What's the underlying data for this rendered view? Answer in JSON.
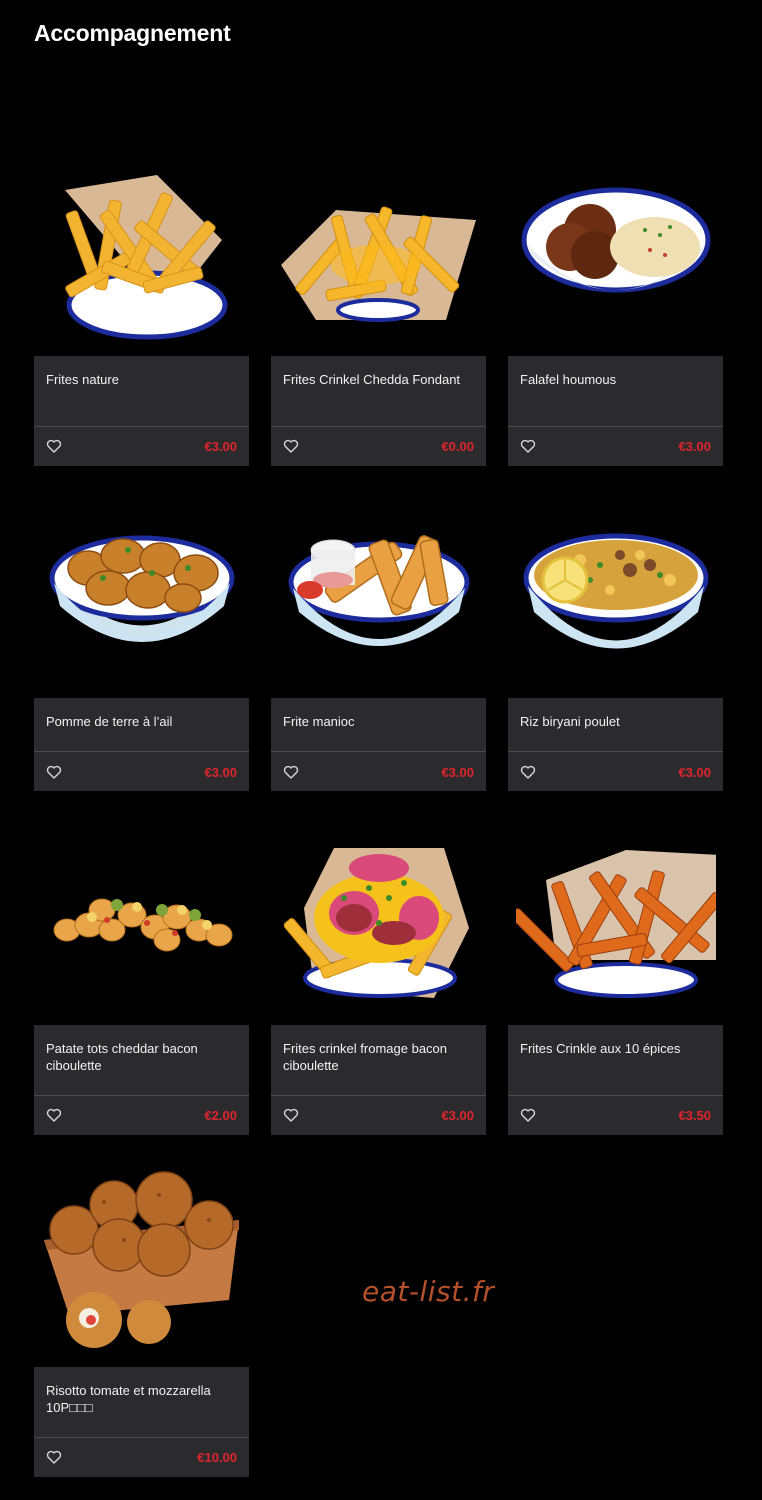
{
  "section": {
    "title": "Accompagnement"
  },
  "colors": {
    "background": "#000000",
    "card": "#2b2b2e",
    "price": "#e0242c",
    "watermark": "#b4512a"
  },
  "items": [
    {
      "name": "Frites nature",
      "price": "€3.00",
      "image": "fries-bowl",
      "icon": "heart-icon"
    },
    {
      "name": "Frites Crinkel Chedda Fondant",
      "price": "€0.00",
      "image": "cheese-fries-tray",
      "icon": "heart-icon"
    },
    {
      "name": "Falafel houmous",
      "price": "€3.00",
      "image": "falafel-hummus-bowl",
      "icon": "heart-icon"
    },
    {
      "name": "Pomme de terre à l’ail",
      "price": "€3.00",
      "image": "garlic-potatoes-bowl",
      "icon": "heart-icon"
    },
    {
      "name": "Frite manioc",
      "price": "€3.00",
      "image": "cassava-fries-bowl",
      "icon": "heart-icon"
    },
    {
      "name": "Riz biryani poulet",
      "price": "€3.00",
      "image": "chicken-biryani-bowl",
      "icon": "heart-icon"
    },
    {
      "name": "Patate tots cheddar bacon ciboulette",
      "price": "€2.00",
      "image": "tater-tots",
      "icon": "heart-icon"
    },
    {
      "name": "Frites crinkel fromage bacon ciboulette",
      "price": "€3.00",
      "image": "loaded-fries-tray",
      "icon": "heart-icon"
    },
    {
      "name": "Frites Crinkle aux 10 épices",
      "price": "€3.50",
      "image": "spiced-fries-tray",
      "icon": "heart-icon"
    },
    {
      "name": "Risotto tomate et mozzarella 10P□□□",
      "price": "€10.00",
      "image": "risotto-balls-box",
      "icon": "heart-icon"
    }
  ],
  "watermark": "eat-list.fr"
}
